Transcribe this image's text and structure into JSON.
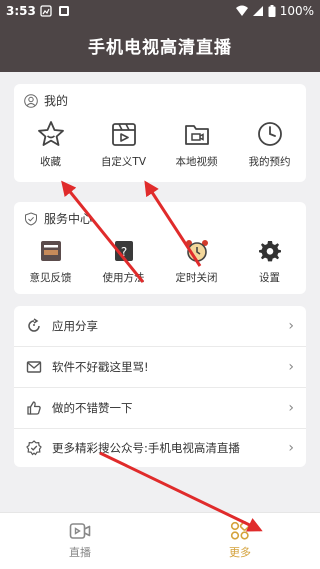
{
  "status_bar": {
    "time": "3:53",
    "battery": "100%"
  },
  "header": {
    "title": "手机电视高清直播"
  },
  "mine": {
    "title": "我的",
    "items": [
      {
        "label": "收藏",
        "icon": "star-icon"
      },
      {
        "label": "自定义TV",
        "icon": "clapperboard-icon"
      },
      {
        "label": "本地视频",
        "icon": "folder-video-icon"
      },
      {
        "label": "我的预约",
        "icon": "clock-icon"
      }
    ]
  },
  "service": {
    "title": "服务中心",
    "items": [
      {
        "label": "意见反馈",
        "icon": "feedback-icon"
      },
      {
        "label": "使用方法",
        "icon": "guide-icon"
      },
      {
        "label": "定时关闭",
        "icon": "alarm-clock-icon"
      },
      {
        "label": "设置",
        "icon": "gear-icon"
      }
    ]
  },
  "menu": [
    {
      "label": "应用分享",
      "icon": "share-icon"
    },
    {
      "label": "软件不好戳这里骂!",
      "icon": "mail-icon"
    },
    {
      "label": "做的不错赞一下",
      "icon": "thumbs-up-icon"
    },
    {
      "label": "更多精彩搜公众号:手机电视高清直播",
      "icon": "badge-check-icon"
    }
  ],
  "tabs": [
    {
      "label": "直播",
      "active": false
    },
    {
      "label": "更多",
      "active": true
    }
  ],
  "colors": {
    "header": "#4d4546",
    "accent": "#d4a23c",
    "arrow": "#e02b2b"
  }
}
